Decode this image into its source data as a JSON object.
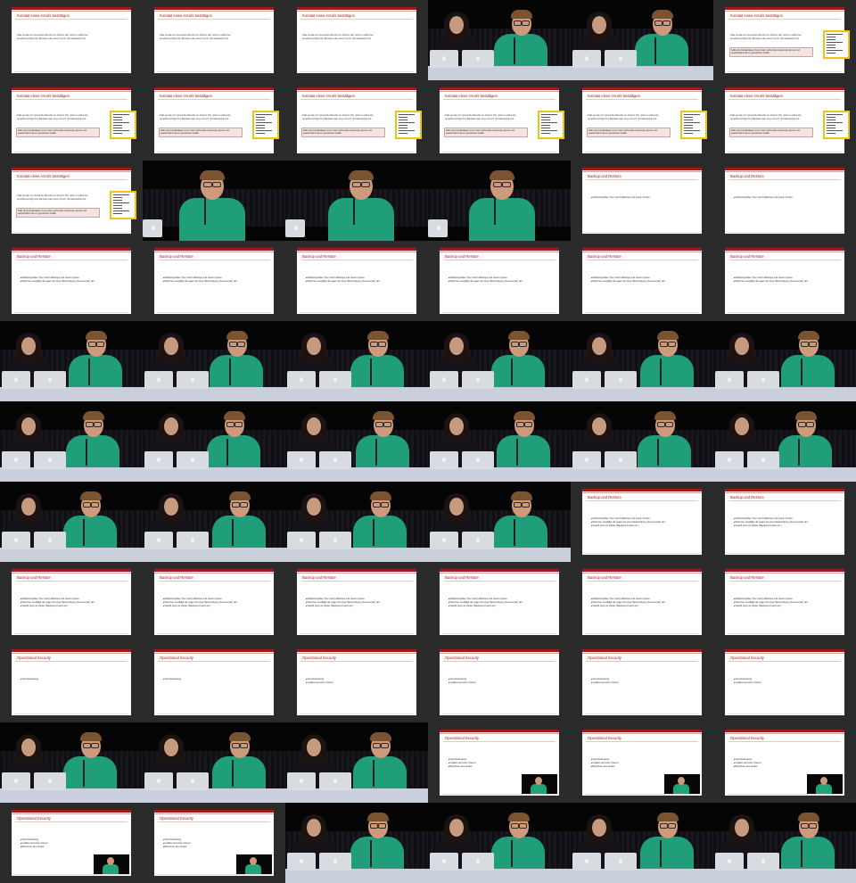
{
  "slide_titles": {
    "kontakt": "Kontakt eines Anrufs bestätigen",
    "backup": "Backup und Restore",
    "opsec": "Operational Security"
  },
  "slide_text": {
    "kontakt_para": "Falls jemals ein Gemeinde Bereich ein Person Teil, sieht er selbst der anrufsberechtigt eine Beispiel oder einen Anruft. (Kontakt)aufnimmt.",
    "kontakt_box": "Falls die Kontaktdaten zuvor oder verbunden Anwender genau und ausdrücklich als zu gemachter Grafik."
  },
  "bullets": {
    "b1": "Hilfswerkgrößen Test, durch Backups und einem Kosten.",
    "b2": "Platzmax sorgfältig die sagen bei einer Beschreibung (Kommentar) der...",
    "b3": "Verteilt auch an Papier (Backups Kosten etc.)",
    "o1": "Verschlüsselung",
    "o2": "Logfiles auf einem Server",
    "o3": "Besuchen des Geräts"
  },
  "layout": {
    "columns": 6,
    "rows": 11,
    "cells": [
      "k0",
      "k0",
      "k0",
      "wm",
      "wm",
      "k1",
      "k1",
      "k1",
      "k1",
      "k1",
      "k1",
      "k1",
      "k1",
      "mc",
      "mc",
      "mc",
      "b1",
      "b1",
      "b2",
      "b2",
      "b2",
      "b2",
      "b2",
      "b2",
      "wm",
      "wm",
      "wm",
      "wm",
      "wm",
      "wm",
      "wm",
      "wm",
      "wm",
      "wm",
      "wm",
      "wm",
      "wm",
      "wm",
      "wm",
      "wm",
      "b3",
      "b3",
      "b3",
      "b3",
      "b3",
      "b3",
      "b3",
      "b3",
      "o1",
      "o1",
      "o2",
      "o2",
      "o2",
      "o2",
      "wm",
      "wm",
      "wm",
      "o3p",
      "o3p",
      "o3p",
      "o3p",
      "o3p",
      "wm",
      "wm",
      "wm",
      "wm"
    ]
  },
  "icons": {
    "bullet": "triangle-bullet-icon",
    "apple": "apple-logo-icon"
  },
  "colors": {
    "accent": "#a11a1a",
    "shirt": "#1f9e79",
    "thumb_border": "#f2c40f"
  }
}
